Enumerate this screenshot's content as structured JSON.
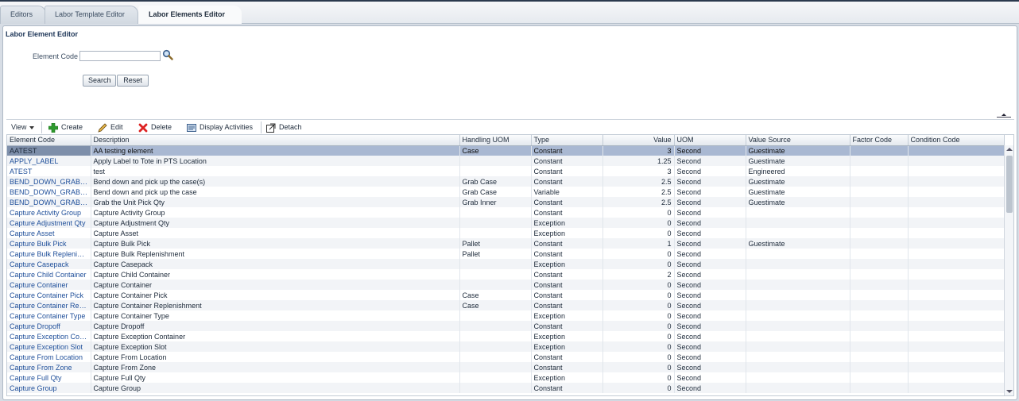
{
  "tabs": [
    {
      "label": "Editors"
    },
    {
      "label": "Labor Template Editor"
    },
    {
      "label": "Labor Elements Editor"
    }
  ],
  "panel": {
    "title": "Labor Element Editor",
    "element_code_label": "Element Code",
    "element_code_value": "",
    "search_button": "Search",
    "reset_button": "Reset"
  },
  "toolbar": {
    "view": "View",
    "create": "Create",
    "edit": "Edit",
    "delete": "Delete",
    "display_activities": "Display Activities",
    "detach": "Detach"
  },
  "colors": {
    "selected_row": "#a9b8d2",
    "link_text": "#1f4f9a",
    "create_icon": "#2e9a2e",
    "delete_icon": "#d22"
  },
  "table": {
    "columns": [
      "Element Code",
      "Description",
      "Handling UOM",
      "Type",
      "Value",
      "UOM",
      "Value Source",
      "Factor Code",
      "Condition Code"
    ],
    "rows": [
      [
        "AATEST",
        "AA testing element",
        "Case",
        "Constant",
        "3",
        "Second",
        "Guestimate",
        "",
        ""
      ],
      [
        "APPLY_LABEL",
        "Apply Label to Tote in PTS Location",
        "",
        "Constant",
        "1.25",
        "Second",
        "Guestimate",
        "",
        ""
      ],
      [
        "ATEST",
        "test",
        "",
        "Constant",
        "3",
        "Second",
        "Engineered",
        "",
        ""
      ],
      [
        "BEND_DOWN_GRAB_C...",
        "Bend down and pick up the case(s)",
        "Grab Case",
        "Constant",
        "2.5",
        "Second",
        "Guestimate",
        "",
        ""
      ],
      [
        "BEND_DOWN_GRAB_F...",
        "Bend down and pick up the case",
        "Grab Case",
        "Variable",
        "2.5",
        "Second",
        "Guestimate",
        "",
        ""
      ],
      [
        "BEND_DOWN_GRAB_U...",
        "Grab the Unit Pick Qty",
        "Grab Inner",
        "Constant",
        "2.5",
        "Second",
        "Guestimate",
        "",
        ""
      ],
      [
        "Capture Activity Group",
        "Capture Activity Group",
        "",
        "Constant",
        "0",
        "Second",
        "",
        "",
        ""
      ],
      [
        "Capture Adjustment Qty",
        "Capture Adjustment Qty",
        "",
        "Exception",
        "0",
        "Second",
        "",
        "",
        ""
      ],
      [
        "Capture Asset",
        "Capture Asset",
        "",
        "Exception",
        "0",
        "Second",
        "",
        "",
        ""
      ],
      [
        "Capture Bulk Pick",
        "Capture Bulk Pick",
        "Pallet",
        "Constant",
        "1",
        "Second",
        "Guestimate",
        "",
        ""
      ],
      [
        "Capture Bulk Replenish...",
        "Capture Bulk Replenishment",
        "Pallet",
        "Constant",
        "0",
        "Second",
        "",
        "",
        ""
      ],
      [
        "Capture Casepack",
        "Capture Casepack",
        "",
        "Exception",
        "0",
        "Second",
        "",
        "",
        ""
      ],
      [
        "Capture Child Container",
        "Capture Child Container",
        "",
        "Constant",
        "2",
        "Second",
        "",
        "",
        ""
      ],
      [
        "Capture Container",
        "Capture Container",
        "",
        "Constant",
        "0",
        "Second",
        "",
        "",
        ""
      ],
      [
        "Capture Container Pick",
        "Capture Container Pick",
        "Case",
        "Constant",
        "0",
        "Second",
        "",
        "",
        ""
      ],
      [
        "Capture Container Repl...",
        "Capture Container Replenishment",
        "Case",
        "Constant",
        "0",
        "Second",
        "",
        "",
        ""
      ],
      [
        "Capture Container Type",
        "Capture Container Type",
        "",
        "Exception",
        "0",
        "Second",
        "",
        "",
        ""
      ],
      [
        "Capture Dropoff",
        "Capture Dropoff",
        "",
        "Constant",
        "0",
        "Second",
        "",
        "",
        ""
      ],
      [
        "Capture Exception Cont...",
        "Capture Exception Container",
        "",
        "Exception",
        "0",
        "Second",
        "",
        "",
        ""
      ],
      [
        "Capture Exception Slot",
        "Capture Exception Slot",
        "",
        "Exception",
        "0",
        "Second",
        "",
        "",
        ""
      ],
      [
        "Capture From Location",
        "Capture From Location",
        "",
        "Constant",
        "0",
        "Second",
        "",
        "",
        ""
      ],
      [
        "Capture From Zone",
        "Capture From Zone",
        "",
        "Constant",
        "0",
        "Second",
        "",
        "",
        ""
      ],
      [
        "Capture Full Qty",
        "Capture Full Qty",
        "",
        "Exception",
        "0",
        "Second",
        "",
        "",
        ""
      ],
      [
        "Capture Group",
        "Capture Group",
        "",
        "Constant",
        "0",
        "Second",
        "",
        "",
        ""
      ]
    ]
  }
}
